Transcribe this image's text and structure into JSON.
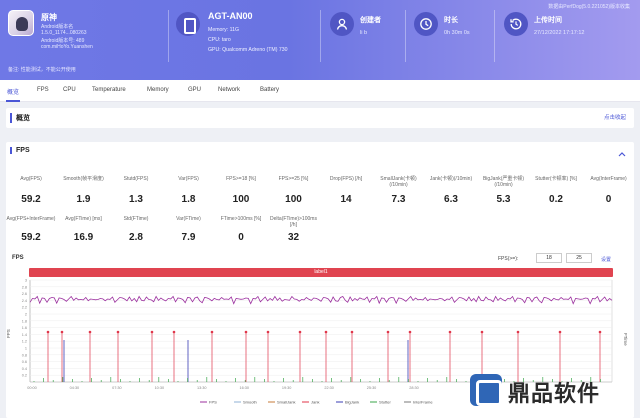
{
  "header": {
    "version": "数据由PerfDog(5.0.221052)版本收集",
    "app": {
      "name": "原神",
      "lines": [
        "Android版本名",
        "1.5.0_1174...080263",
        "Android版本号: 489",
        "com.miHoYo.Yuanshen"
      ]
    },
    "device": {
      "name": "AGT-AN00",
      "lines": [
        "Memory: 11G",
        "CPU: taro",
        "GPU: Qualcomm Adreno (TM) 730"
      ]
    },
    "stats": [
      {
        "label": "创建者",
        "value": "li b",
        "icon": "user-icon"
      },
      {
        "label": "时长",
        "value": "0h 30m 0s",
        "icon": "clock-icon"
      },
      {
        "label": "上传时间",
        "value": "27/12/2022 17:17:12",
        "icon": "history-icon"
      }
    ],
    "note": "备注: 性能测试，不能公开使用"
  },
  "tabs": [
    "概览",
    "FPS",
    "CPU",
    "Temperature",
    "Memory",
    "GPU",
    "Network",
    "Battery"
  ],
  "overview": {
    "title": "概览",
    "collapse": "点击收起"
  },
  "fps_section": {
    "title": "FPS",
    "row1": [
      {
        "label": "Avg(FPS)",
        "value": "59.2"
      },
      {
        "label": "Smooth(帧平滑度)",
        "value": "1.9"
      },
      {
        "label": "Stutd(FPS)",
        "value": "1.3"
      },
      {
        "label": "Var(FPS)",
        "value": "1.8"
      },
      {
        "label": "FPS>=18 [%]",
        "value": "100"
      },
      {
        "label": "FPS>=25 [%]",
        "value": "100"
      },
      {
        "label": "Drop(FPS) [/h]",
        "value": "14"
      },
      {
        "label": "SmallJank(卡顿)(/10min)",
        "value": "7.3"
      },
      {
        "label": "Jank(卡顿)(/10min)",
        "value": "6.3"
      },
      {
        "label": "BigJank(严重卡顿)(/10min)",
        "value": "5.3"
      },
      {
        "label": "Stutter(卡顿率) [%]",
        "value": "0.2"
      },
      {
        "label": "Avg(InterFrame)",
        "value": "0"
      }
    ],
    "row2": [
      {
        "label": "Avg(FPS+InterFrame)",
        "value": "59.2"
      },
      {
        "label": "Avg(FTime) [ms]",
        "value": "16.9"
      },
      {
        "label": "Std(FTime)",
        "value": "2.8"
      },
      {
        "label": "Var(FTime)",
        "value": "7.9"
      },
      {
        "label": "FTime>100ms [%]",
        "value": "0"
      },
      {
        "label": "Delta(FTime)>100ms [/h]",
        "value": "32"
      }
    ]
  },
  "chart": {
    "label": "FPS",
    "filter_label": "FPS(>=):",
    "filter_min": "18",
    "filter_max": "25",
    "settings": "设置",
    "bar_label": "label1",
    "y_axis_label": "FPS",
    "y_right_label": "FTime",
    "legend": [
      "FPS",
      "Smooth",
      "SmallJank",
      "Jank",
      "BigJank",
      "Stutter",
      "InterFrame"
    ],
    "colors": {
      "fps": "#9b2f9e",
      "jank": "#e0364a",
      "bigjank": "#3a3db4",
      "green": "#3aa64a",
      "accent": "#4a56d6"
    }
  },
  "chart_data": {
    "type": "line",
    "series": [
      {
        "name": "FPS",
        "values": [
          58,
          60,
          59,
          60,
          57,
          60,
          59,
          58,
          60,
          60,
          59,
          57,
          60,
          59,
          60,
          58,
          59,
          60,
          59,
          60
        ]
      }
    ],
    "y_ticks": [
      "0.2",
      "0.4",
      "0.6",
      "0.8",
      "1",
      "1.2",
      "1.4",
      "1.6",
      "1.8",
      "2",
      "2.2",
      "2.4",
      "2.6",
      "2.8",
      "3"
    ],
    "x_ticks": [
      "00:00",
      "04:30",
      "07:30",
      "10:30",
      "13:30",
      "16:30",
      "19:30",
      "22:30",
      "25:30",
      "28:30"
    ]
  },
  "watermark": {
    "text": "鼎品软件"
  }
}
